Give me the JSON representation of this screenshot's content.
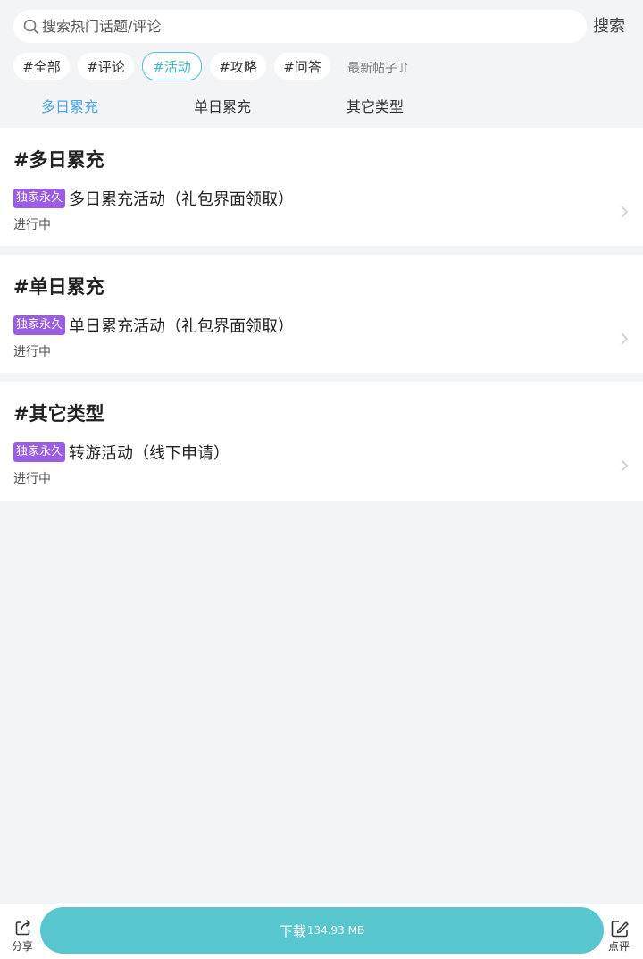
{
  "search": {
    "placeholder": "搜索热门话题/评论",
    "button_label": "搜索"
  },
  "tags": [
    {
      "label": "#全部",
      "active": false
    },
    {
      "label": "#评论",
      "active": false
    },
    {
      "label": "#活动",
      "active": true
    },
    {
      "label": "#攻略",
      "active": false
    },
    {
      "label": "#问答",
      "active": false
    }
  ],
  "sort": {
    "label": "最新帖子",
    "icon": "sort-arrows-icon"
  },
  "category_tabs": [
    {
      "label": "多日累充",
      "active": true
    },
    {
      "label": "单日累充",
      "active": false
    },
    {
      "label": "其它类型",
      "active": false
    }
  ],
  "sections": [
    {
      "title": "#多日累充",
      "items": [
        {
          "badge": "独家永久",
          "title": "多日累充活动（礼包界面领取）",
          "status": "进行中"
        }
      ]
    },
    {
      "title": "#单日累充",
      "items": [
        {
          "badge": "独家永久",
          "title": "单日累充活动（礼包界面领取）",
          "status": "进行中"
        }
      ]
    },
    {
      "title": "#其它类型",
      "items": [
        {
          "badge": "独家永久",
          "title": "转游活动（线下申请）",
          "status": "进行中"
        }
      ]
    }
  ],
  "bottom_bar": {
    "share_label": "分享",
    "download_label": "下载",
    "download_size": "134.93 MB",
    "comment_label": "点评"
  },
  "colors": {
    "accent": "#58c6cf",
    "active_tab": "#4aa7e8",
    "badge": "#9b5de5",
    "background": "#f3f4f6"
  }
}
